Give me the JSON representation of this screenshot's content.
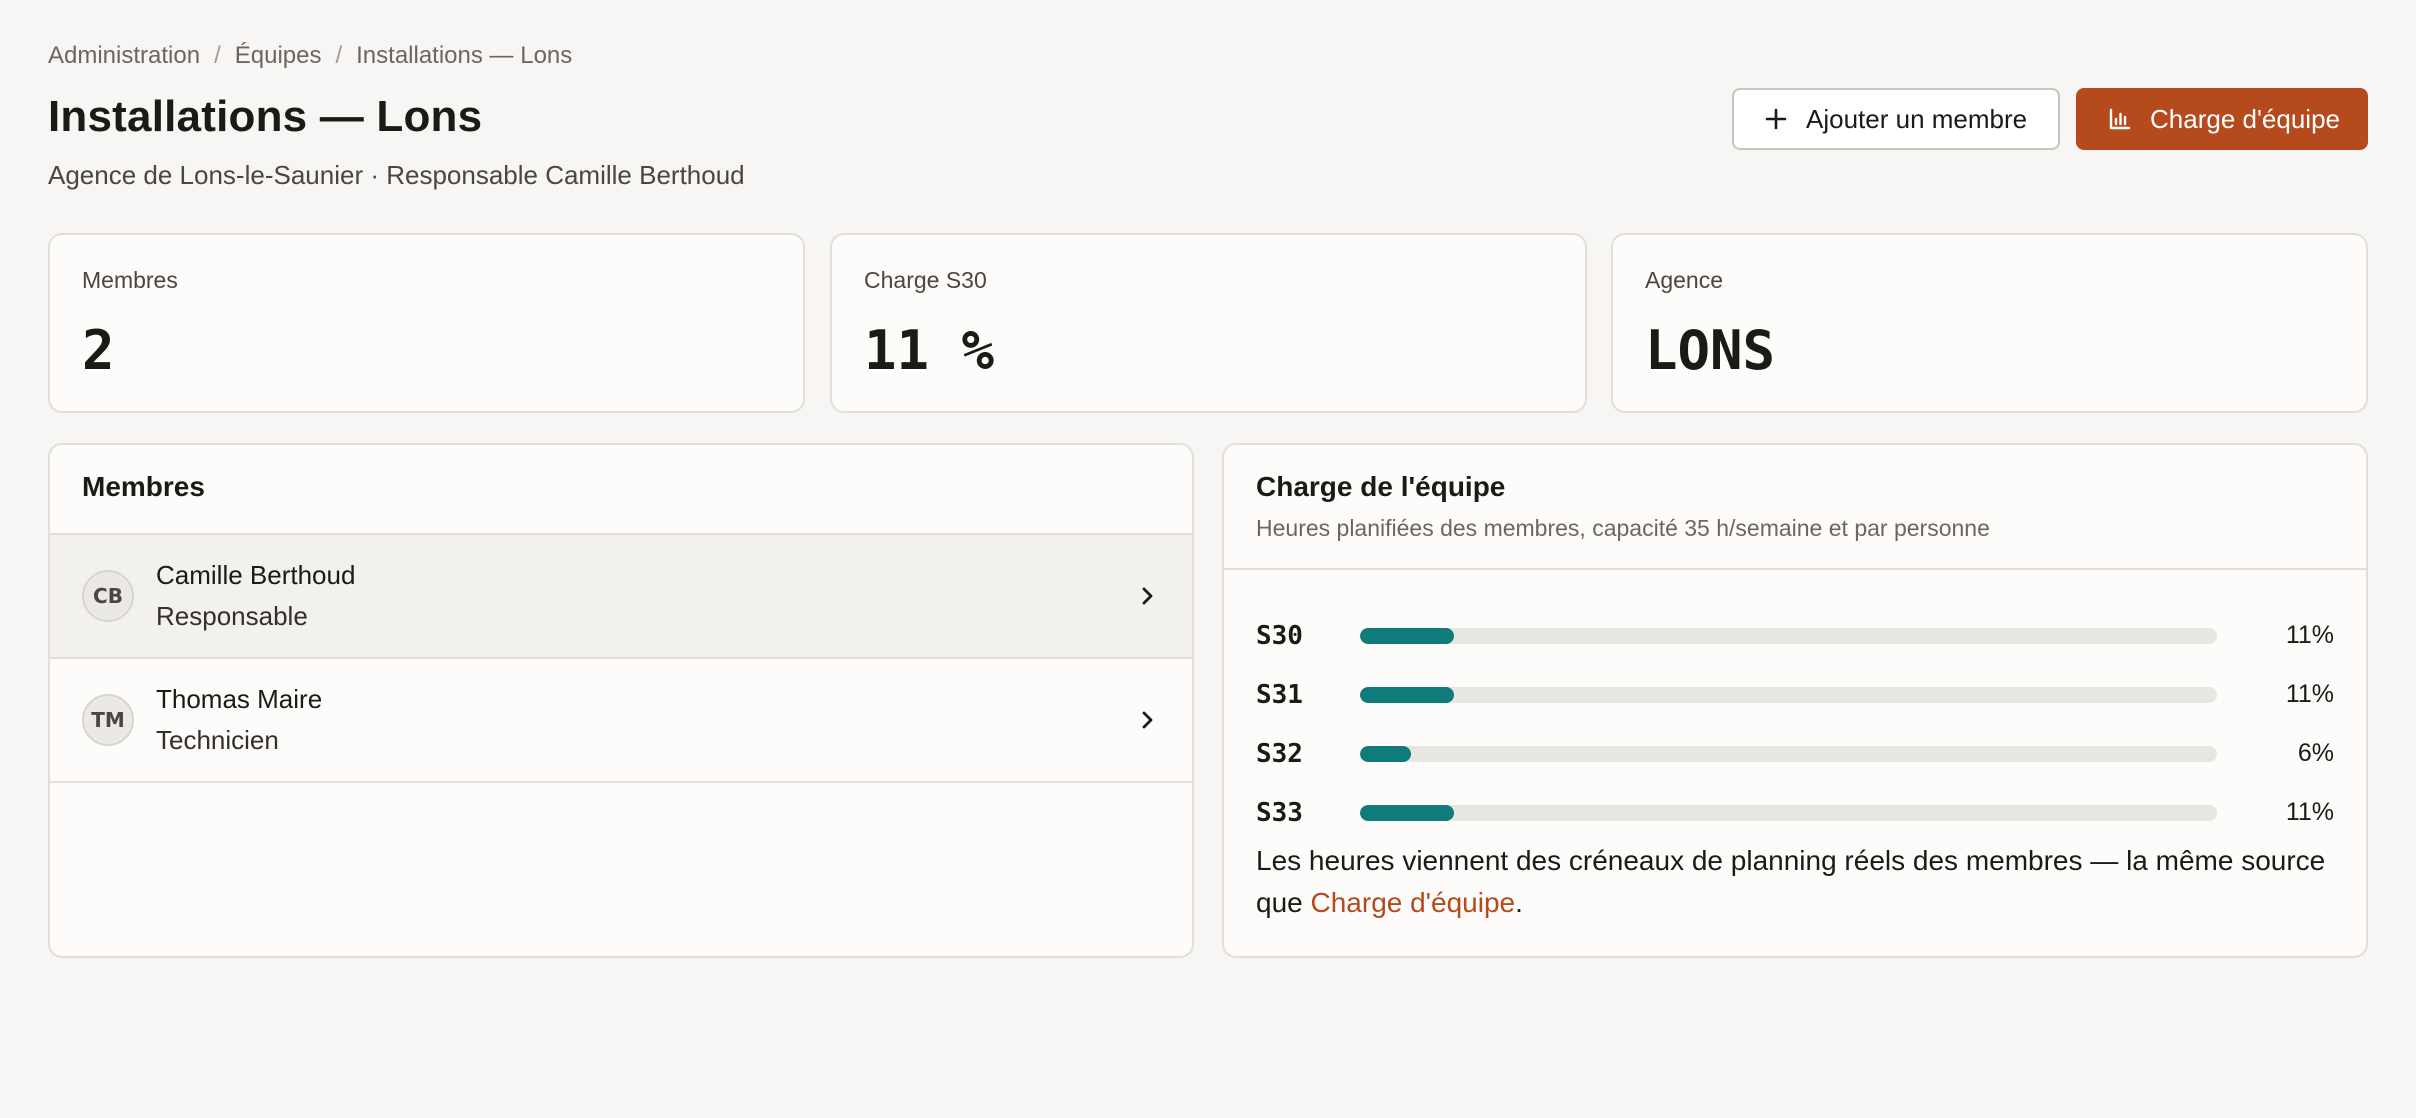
{
  "breadcrumb": [
    "Administration",
    "Équipes",
    "Installations — Lons"
  ],
  "breadcrumb_separator": "/",
  "page": {
    "title": "Installations — Lons",
    "subtitle": "Agence de Lons-le-Saunier · Responsable Camille Berthoud"
  },
  "actions": {
    "add_member": "Ajouter un membre",
    "team_load": "Charge d'équipe"
  },
  "stats": [
    {
      "label": "Membres",
      "value": "2"
    },
    {
      "label": "Charge S30",
      "value": "11 %"
    },
    {
      "label": "Agence",
      "value": "LONS"
    }
  ],
  "members": {
    "title": "Membres",
    "items": [
      {
        "initials": "CB",
        "name": "Camille Berthoud",
        "role": "Responsable"
      },
      {
        "initials": "TM",
        "name": "Thomas Maire",
        "role": "Technicien"
      }
    ]
  },
  "charge": {
    "title": "Charge de l'équipe",
    "subtitle": "Heures planifiées des membres, capacité 35 h/semaine et par personne",
    "weeks": [
      {
        "week": "S30",
        "percent": 11,
        "label": "11%"
      },
      {
        "week": "S31",
        "percent": 11,
        "label": "11%"
      },
      {
        "week": "S32",
        "percent": 6,
        "label": "6%"
      },
      {
        "week": "S33",
        "percent": 11,
        "label": "11%"
      }
    ],
    "note_text": "Les heures viennent des créneaux de planning réels des membres — la même source que ",
    "note_link": "Charge d'équipe",
    "note_end": "."
  },
  "colors": {
    "accent": "#b54a1c",
    "bar_fill": "#0f7b7b",
    "bar_track": "#e8e6e1"
  }
}
